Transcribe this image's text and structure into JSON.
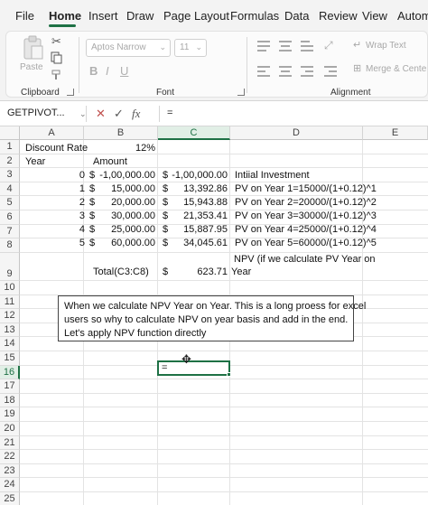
{
  "menu": {
    "items": [
      {
        "label": "File"
      },
      {
        "label": "Home"
      },
      {
        "label": "Insert"
      },
      {
        "label": "Draw"
      },
      {
        "label": "Page Layout"
      },
      {
        "label": "Formulas"
      },
      {
        "label": "Data"
      },
      {
        "label": "Review"
      },
      {
        "label": "View"
      },
      {
        "label": "Autom"
      }
    ],
    "active": "Home"
  },
  "ribbon": {
    "clipboard": {
      "paste_label": "Paste",
      "group_label": "Clipboard"
    },
    "font": {
      "font_name": "Aptos Narrow",
      "font_size": "11",
      "bold": "B",
      "italic": "I",
      "underline": "U",
      "group_label": "Font"
    },
    "alignment": {
      "wrap_text": "Wrap Text",
      "merge_center": "Merge & Cente",
      "group_label": "Alignment"
    }
  },
  "formula_bar": {
    "name_box": "GETPIVOT...",
    "cancel_icon": "close-icon",
    "enter_icon": "check-icon",
    "fx_label": "fx",
    "formula": "="
  },
  "columns": [
    "A",
    "B",
    "C",
    "D",
    "E"
  ],
  "rows": [
    "1",
    "2",
    "3",
    "4",
    "5",
    "6",
    "7",
    "8",
    "9",
    "10",
    "11",
    "12",
    "13",
    "14",
    "15",
    "16",
    "17",
    "18",
    "19",
    "20",
    "21",
    "22",
    "23",
    "24",
    "25"
  ],
  "cells": {
    "a1": "Discount Rate",
    "b1": "12%",
    "a2": "Year",
    "b2": "Amount",
    "a3": "0",
    "b3_sym": "$",
    "b3": "-1,00,000.00",
    "c3_sym": "$",
    "c3": "-1,00,000.00",
    "d3": "Intiial Investment",
    "a4": "1",
    "b4_sym": "$",
    "b4": "15,000.00",
    "c4_sym": "$",
    "c4": "13,392.86",
    "d4": "PV on Year 1=15000/(1+0.12)^1",
    "a5": "2",
    "b5_sym": "$",
    "b5": "20,000.00",
    "c5_sym": "$",
    "c5": "15,943.88",
    "d5": "PV on Year 2=20000/(1+0.12)^2",
    "a6": "3",
    "b6_sym": "$",
    "b6": "30,000.00",
    "c6_sym": "$",
    "c6": "21,353.41",
    "d6": "PV on Year 3=30000/(1+0.12)^3",
    "a7": "4",
    "b7_sym": "$",
    "b7": "25,000.00",
    "c7_sym": "$",
    "c7": "15,887.95",
    "d7": "PV on Year 4=25000/(1+0.12)^4",
    "a8": "5",
    "b8_sym": "$",
    "b8": "60,000.00",
    "c8_sym": "$",
    "c8": "34,045.61",
    "d8": "PV on Year 5=60000/(1+0.12)^5",
    "b9": "Total(C3:C8)",
    "c9_sym": "$",
    "c9": "623.71",
    "d9_line1": "NPV (if we calculate PV Year on",
    "d9_line2": "Year",
    "b16": "="
  },
  "note": {
    "line1": "When we calculate NPV Year on Year. This is a long proess for excel",
    "line2": "users so why to  calculate NPV on year basis and add in the end.",
    "line3": "Let's apply NPV function directly"
  },
  "active_cell": "C16",
  "colors": {
    "accent": "#1e7145"
  }
}
